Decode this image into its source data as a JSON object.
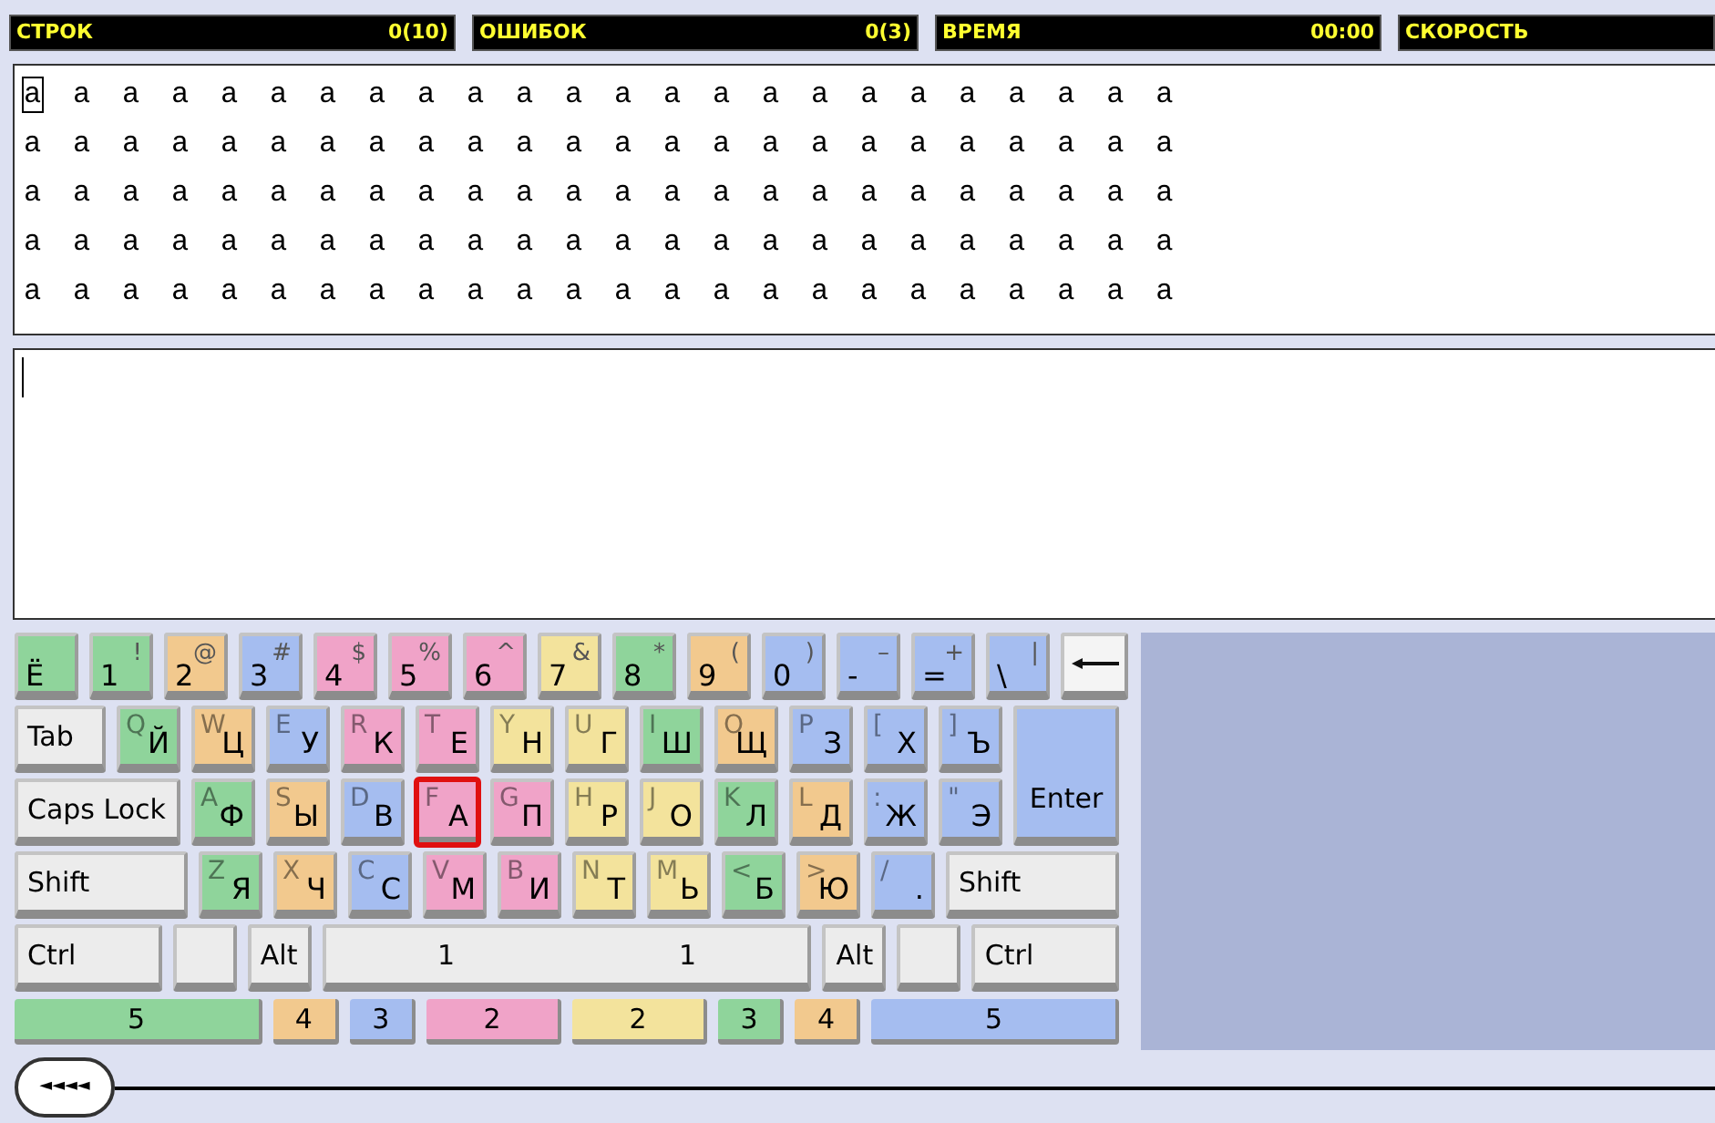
{
  "stats": [
    {
      "label": "СТРОК",
      "value": "0(10)"
    },
    {
      "label": "ОШИБОК",
      "value": "0(3)"
    },
    {
      "label": "ВРЕМЯ",
      "value": "00:00"
    },
    {
      "label": "СКОРОСТЬ"
    }
  ],
  "exercise": {
    "current_char": "a",
    "lines": [
      "a a a a a a a a a a a a a a a a a a a a a a a",
      "a a a a a a a a a a a a a a a a a a a a a a a a",
      "a a a a a a a a a a a a a a a a a a a a a a a a",
      "a a a a a a a a a a a a a a a a a a a a a a a a",
      "a a a a a a a a a a a a a a a a a a a a a a a a"
    ]
  },
  "keyboard": {
    "rows": [
      {
        "keys": [
          {
            "kind": "digit",
            "main": "Ё",
            "color": "#8fd49b",
            "selected": false
          },
          {
            "kind": "digit",
            "main": "1",
            "shift": "!",
            "color": "#8fd49b",
            "selected": false
          },
          {
            "kind": "digit",
            "main": "2",
            "shift": "@",
            "color": "#f2c98e",
            "selected": false
          },
          {
            "kind": "digit",
            "main": "3",
            "shift": "#",
            "color": "#a5bdf0",
            "selected": false
          },
          {
            "kind": "digit",
            "main": "4",
            "shift": "$",
            "color": "#f0a3c8",
            "selected": false
          },
          {
            "kind": "digit",
            "main": "5",
            "shift": "%",
            "color": "#f0a3c8",
            "selected": false
          },
          {
            "kind": "digit",
            "main": "6",
            "shift": "^",
            "color": "#f0a3c8",
            "selected": false
          },
          {
            "kind": "digit",
            "main": "7",
            "shift": "&",
            "color": "#f3e39c",
            "selected": false
          },
          {
            "kind": "digit",
            "main": "8",
            "shift": "*",
            "color": "#8fd49b",
            "selected": false
          },
          {
            "kind": "digit",
            "main": "9",
            "shift": "(",
            "color": "#f2c98e",
            "selected": false
          },
          {
            "kind": "digit",
            "main": "0",
            "shift": ")",
            "color": "#a5bdf0",
            "selected": false
          },
          {
            "kind": "digit",
            "main": "-",
            "shift": "–",
            "color": "#a5bdf0",
            "selected": false
          },
          {
            "kind": "digit",
            "main": "=",
            "shift": "+",
            "color": "#a5bdf0",
            "selected": false
          },
          {
            "kind": "digit",
            "main": "\\",
            "shift": "|",
            "color": "#a5bdf0",
            "selected": false
          },
          {
            "kind": "backspace",
            "selected": false
          }
        ]
      },
      {
        "keys": [
          {
            "kind": "modifier",
            "label": "Tab",
            "selected": false
          },
          {
            "kind": "letter",
            "latin": "Q",
            "cyrillic": "Й",
            "color": "#8fd49b",
            "selected": false
          },
          {
            "kind": "letter",
            "latin": "W",
            "cyrillic": "Ц",
            "color": "#f2c98e",
            "selected": false
          },
          {
            "kind": "letter",
            "latin": "E",
            "cyrillic": "У",
            "color": "#a5bdf0",
            "selected": false
          },
          {
            "kind": "letter",
            "latin": "R",
            "cyrillic": "К",
            "color": "#f0a3c8",
            "selected": false
          },
          {
            "kind": "letter",
            "latin": "T",
            "cyrillic": "Е",
            "color": "#f0a3c8",
            "selected": false
          },
          {
            "kind": "letter",
            "latin": "Y",
            "cyrillic": "Н",
            "color": "#f3e39c",
            "selected": false
          },
          {
            "kind": "letter",
            "latin": "U",
            "cyrillic": "Г",
            "color": "#f3e39c",
            "selected": false
          },
          {
            "kind": "letter",
            "latin": "I",
            "cyrillic": "Ш",
            "color": "#8fd49b",
            "selected": false
          },
          {
            "kind": "letter",
            "latin": "O",
            "cyrillic": "Щ",
            "color": "#f2c98e",
            "selected": false
          },
          {
            "kind": "letter",
            "latin": "P",
            "cyrillic": "З",
            "color": "#a5bdf0",
            "selected": false
          },
          {
            "kind": "letter",
            "latin": "[",
            "cyrillic": "Х",
            "color": "#a5bdf0",
            "selected": false
          },
          {
            "kind": "letter",
            "latin": "]",
            "cyrillic": "Ъ",
            "color": "#a5bdf0",
            "selected": false
          }
        ]
      },
      {
        "keys": [
          {
            "kind": "modifier",
            "label": "Caps Lock",
            "selected": false
          },
          {
            "kind": "letter",
            "latin": "A",
            "cyrillic": "Ф",
            "color": "#8fd49b",
            "selected": false
          },
          {
            "kind": "letter",
            "latin": "S",
            "cyrillic": "Ы",
            "color": "#f2c98e",
            "selected": false
          },
          {
            "kind": "letter",
            "latin": "D",
            "cyrillic": "В",
            "color": "#a5bdf0",
            "selected": false
          },
          {
            "kind": "letter",
            "latin": "F",
            "cyrillic": "А",
            "color": "#f0a3c8",
            "selected": true
          },
          {
            "kind": "letter",
            "latin": "G",
            "cyrillic": "П",
            "color": "#f0a3c8",
            "selected": false
          },
          {
            "kind": "letter",
            "latin": "H",
            "cyrillic": "Р",
            "color": "#f3e39c",
            "selected": false
          },
          {
            "kind": "letter",
            "latin": "J",
            "cyrillic": "О",
            "color": "#f3e39c",
            "selected": false
          },
          {
            "kind": "letter",
            "latin": "K",
            "cyrillic": "Л",
            "color": "#8fd49b",
            "selected": false
          },
          {
            "kind": "letter",
            "latin": "L",
            "cyrillic": "Д",
            "color": "#f2c98e",
            "selected": false
          },
          {
            "kind": "letter",
            "latin": ":",
            "cyrillic": "Ж",
            "color": "#a5bdf0",
            "selected": false
          },
          {
            "kind": "letter",
            "latin": "\"",
            "cyrillic": "Э",
            "color": "#a5bdf0",
            "selected": false
          }
        ]
      },
      {
        "keys": [
          {
            "kind": "modifier",
            "label": "Shift",
            "selected": false
          },
          {
            "kind": "letter",
            "latin": "Z",
            "cyrillic": "Я",
            "color": "#8fd49b",
            "selected": false
          },
          {
            "kind": "letter",
            "latin": "X",
            "cyrillic": "Ч",
            "color": "#f2c98e",
            "selected": false
          },
          {
            "kind": "letter",
            "latin": "C",
            "cyrillic": "С",
            "color": "#a5bdf0",
            "selected": false
          },
          {
            "kind": "letter",
            "latin": "V",
            "cyrillic": "М",
            "color": "#f0a3c8",
            "selected": false
          },
          {
            "kind": "letter",
            "latin": "B",
            "cyrillic": "И",
            "color": "#f0a3c8",
            "selected": false
          },
          {
            "kind": "letter",
            "latin": "N",
            "cyrillic": "Т",
            "color": "#f3e39c",
            "selected": false
          },
          {
            "kind": "letter",
            "latin": "M",
            "cyrillic": "Ь",
            "color": "#f3e39c",
            "selected": false
          },
          {
            "kind": "letter",
            "latin": "<",
            "cyrillic": "Б",
            "color": "#8fd49b",
            "selected": false
          },
          {
            "kind": "letter",
            "latin": ">",
            "cyrillic": "Ю",
            "color": "#f2c98e",
            "selected": false
          },
          {
            "kind": "letter",
            "latin": "/",
            "cyrillic": ".",
            "color": "#a5bdf0",
            "selected": false
          },
          {
            "kind": "modifier",
            "label": "Shift",
            "selected": false
          }
        ]
      },
      {
        "keys": [
          {
            "kind": "modifier",
            "label": "Ctrl",
            "selected": false
          },
          {
            "kind": "blank",
            "selected": false
          },
          {
            "kind": "small",
            "label": "Alt",
            "selected": false
          },
          {
            "kind": "space",
            "labels": [
              "1",
              "1"
            ],
            "selected": false
          },
          {
            "kind": "small",
            "label": "Alt",
            "selected": false
          },
          {
            "kind": "blank",
            "selected": false
          },
          {
            "kind": "modifier",
            "label": "Ctrl",
            "selected": false
          }
        ]
      }
    ],
    "enter": {
      "label": "Enter",
      "color": "#a5bdf0",
      "selected": false
    }
  },
  "fingers": [
    {
      "label": "5",
      "color": "#8fd49b",
      "kind": "wide"
    },
    {
      "label": "4",
      "color": "#f2c98e",
      "kind": "narrow"
    },
    {
      "label": "3",
      "color": "#a5bdf0",
      "kind": "narrow"
    },
    {
      "label": "2",
      "color": "#f0a3c8",
      "kind": "medium"
    },
    {
      "label": "2",
      "color": "#f3e39c",
      "kind": "medium"
    },
    {
      "label": "3",
      "color": "#8fd49b",
      "kind": "narrow"
    },
    {
      "label": "4",
      "color": "#f2c98e",
      "kind": "narrow"
    },
    {
      "label": "5",
      "color": "#a5bdf0",
      "kind": "wide"
    }
  ],
  "back_button": {
    "label": "◄◄◄◄"
  }
}
